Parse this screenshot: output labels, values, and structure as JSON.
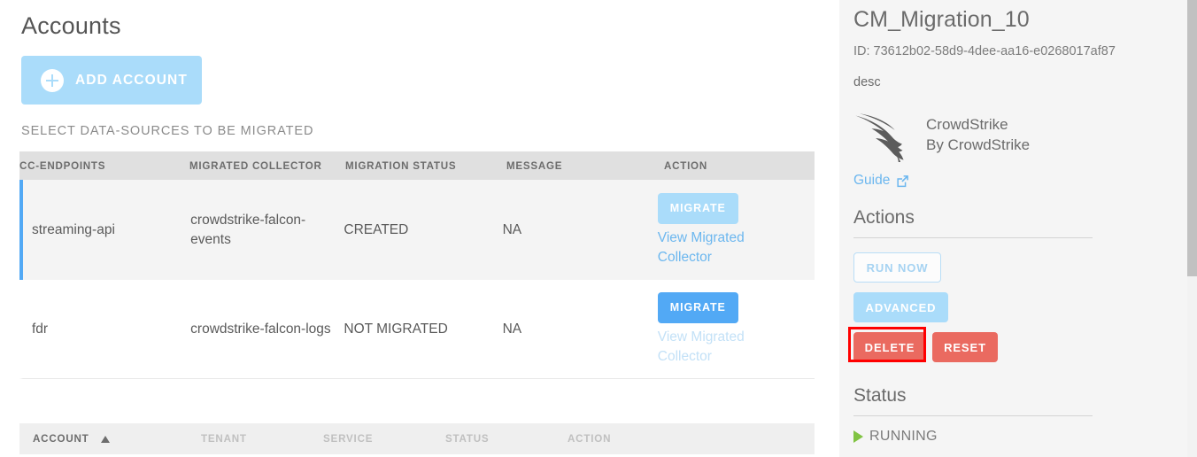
{
  "main": {
    "page_title": "Accounts",
    "add_account_label": "ADD ACCOUNT",
    "section_label": "SELECT DATA-SOURCES TO BE MIGRATED",
    "datasources_table": {
      "headers": [
        "CC-ENDPOINTS",
        "MIGRATED COLLECTOR",
        "MIGRATION STATUS",
        "MESSAGE",
        "ACTION"
      ],
      "rows": [
        {
          "cc_endpoint": "streaming-api",
          "migrated_collector": "crowdstrike-falcon-events",
          "migration_status": "CREATED",
          "message": "NA",
          "migrate_label": "MIGRATE",
          "view_link_label": "View Migrated Collector",
          "selected": true
        },
        {
          "cc_endpoint": "fdr",
          "migrated_collector": "crowdstrike-falcon-logs",
          "migration_status": "NOT MIGRATED",
          "message": "NA",
          "migrate_label": "MIGRATE",
          "view_link_label": "View Migrated Collector",
          "selected": false
        }
      ]
    },
    "accounts_table": {
      "headers": [
        "ACCOUNT",
        "TENANT",
        "SERVICE",
        "STATUS",
        "ACTION"
      ],
      "sorted_column": "ACCOUNT",
      "sort_direction": "ascending"
    }
  },
  "detail": {
    "title": "CM_Migration_10",
    "id_line": "ID: 73612b02-58d9-4dee-aa16-e0268017af87",
    "description": "desc",
    "vendor": {
      "name": "CrowdStrike",
      "by_line": "By CrowdStrike",
      "logo_icon": "crowdstrike-falcon-logo"
    },
    "guide_label": "Guide",
    "guide_icon": "external-link-icon",
    "actions": {
      "heading": "Actions",
      "run_now_label": "RUN NOW",
      "advanced_label": "ADVANCED",
      "delete_label": "DELETE",
      "reset_label": "RESET"
    },
    "status": {
      "heading": "Status",
      "value": "RUNNING",
      "icon": "play-triangle-icon"
    }
  },
  "colors": {
    "accent_blue": "#52a9f5",
    "accent_blue_light": "#aadcfa",
    "link_blue": "#6cb7ef",
    "danger_red": "#ea6a60",
    "highlight_red": "#ff0000",
    "status_green": "#80c342",
    "panel_gray": "#f5f5f5"
  }
}
